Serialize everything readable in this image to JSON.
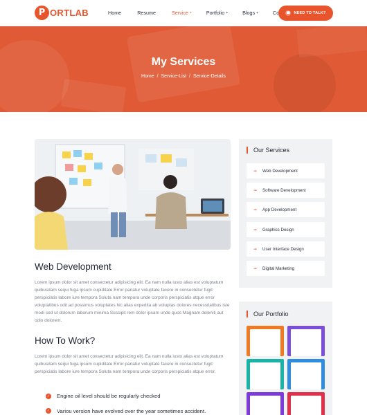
{
  "header": {
    "logo_letter": "P",
    "logo_text": "ORTLAB",
    "nav": [
      {
        "label": "Home",
        "caret": ""
      },
      {
        "label": "Resume",
        "caret": ""
      },
      {
        "label": "Service",
        "caret": "+"
      },
      {
        "label": "Portfolio",
        "caret": "+"
      },
      {
        "label": "Blogs",
        "caret": "+"
      },
      {
        "label": "Contact",
        "caret": ""
      }
    ],
    "cta_label": "NEED TO TALK?",
    "accent": "#e8542c"
  },
  "hero": {
    "title": "My Services",
    "breadcrumb": [
      "Home",
      "/",
      "Service-List",
      "/",
      "Service-Details"
    ]
  },
  "main": {
    "heading1": "Web Development",
    "paragraph1": "Lorem ipsum dolor sit amet consectetur adipisicing elit. Ea nam nulla iusto alias est voluptatum quibusdam sequi fuga ipsum cupiditate Error pariatur voluptate facere in consectetur fugit perspiciatis labore iure tempora Soluta nam tempora unde corporis perspiciatis atque error voluptatibus odit ad possimus voluptates hic alias expedita ab voluptas dolores necessitatibus iste modi sed ut dolorum laborum minima Suscipit rem dolor ipsam unde quos Magnam deleniti aut odio dolorem.",
    "heading2": "How To Work?",
    "paragraph2": "Lorem ipsum dolor sit amet consectetur adipisicing elit. Ea nam nulla iusto alias est voluptatum quibusdam sequi fuga ipsum cupiditate Error pariatur voluptate facere in consectetur fugit perspiciatis labore iure tempora Soluta nam tempora unde corporis perspiciatis atque error.",
    "checks": [
      "Engine oil level should be regularly checked",
      "Variou version have evolved over the year sometimes accident."
    ]
  },
  "sidebar": {
    "services_title": "Our Services",
    "services": [
      "Web Development",
      "Software Development",
      "App Development",
      "Graphics Design",
      "User Interface Design",
      "Digital Marketing"
    ],
    "portfolio_title": "Our Portfolio",
    "portfolio_colors": [
      "#f07a24",
      "#7b4fd8",
      "#19b3a8",
      "#2f8de0",
      "#7c3ad8",
      "#e22f4a"
    ]
  }
}
